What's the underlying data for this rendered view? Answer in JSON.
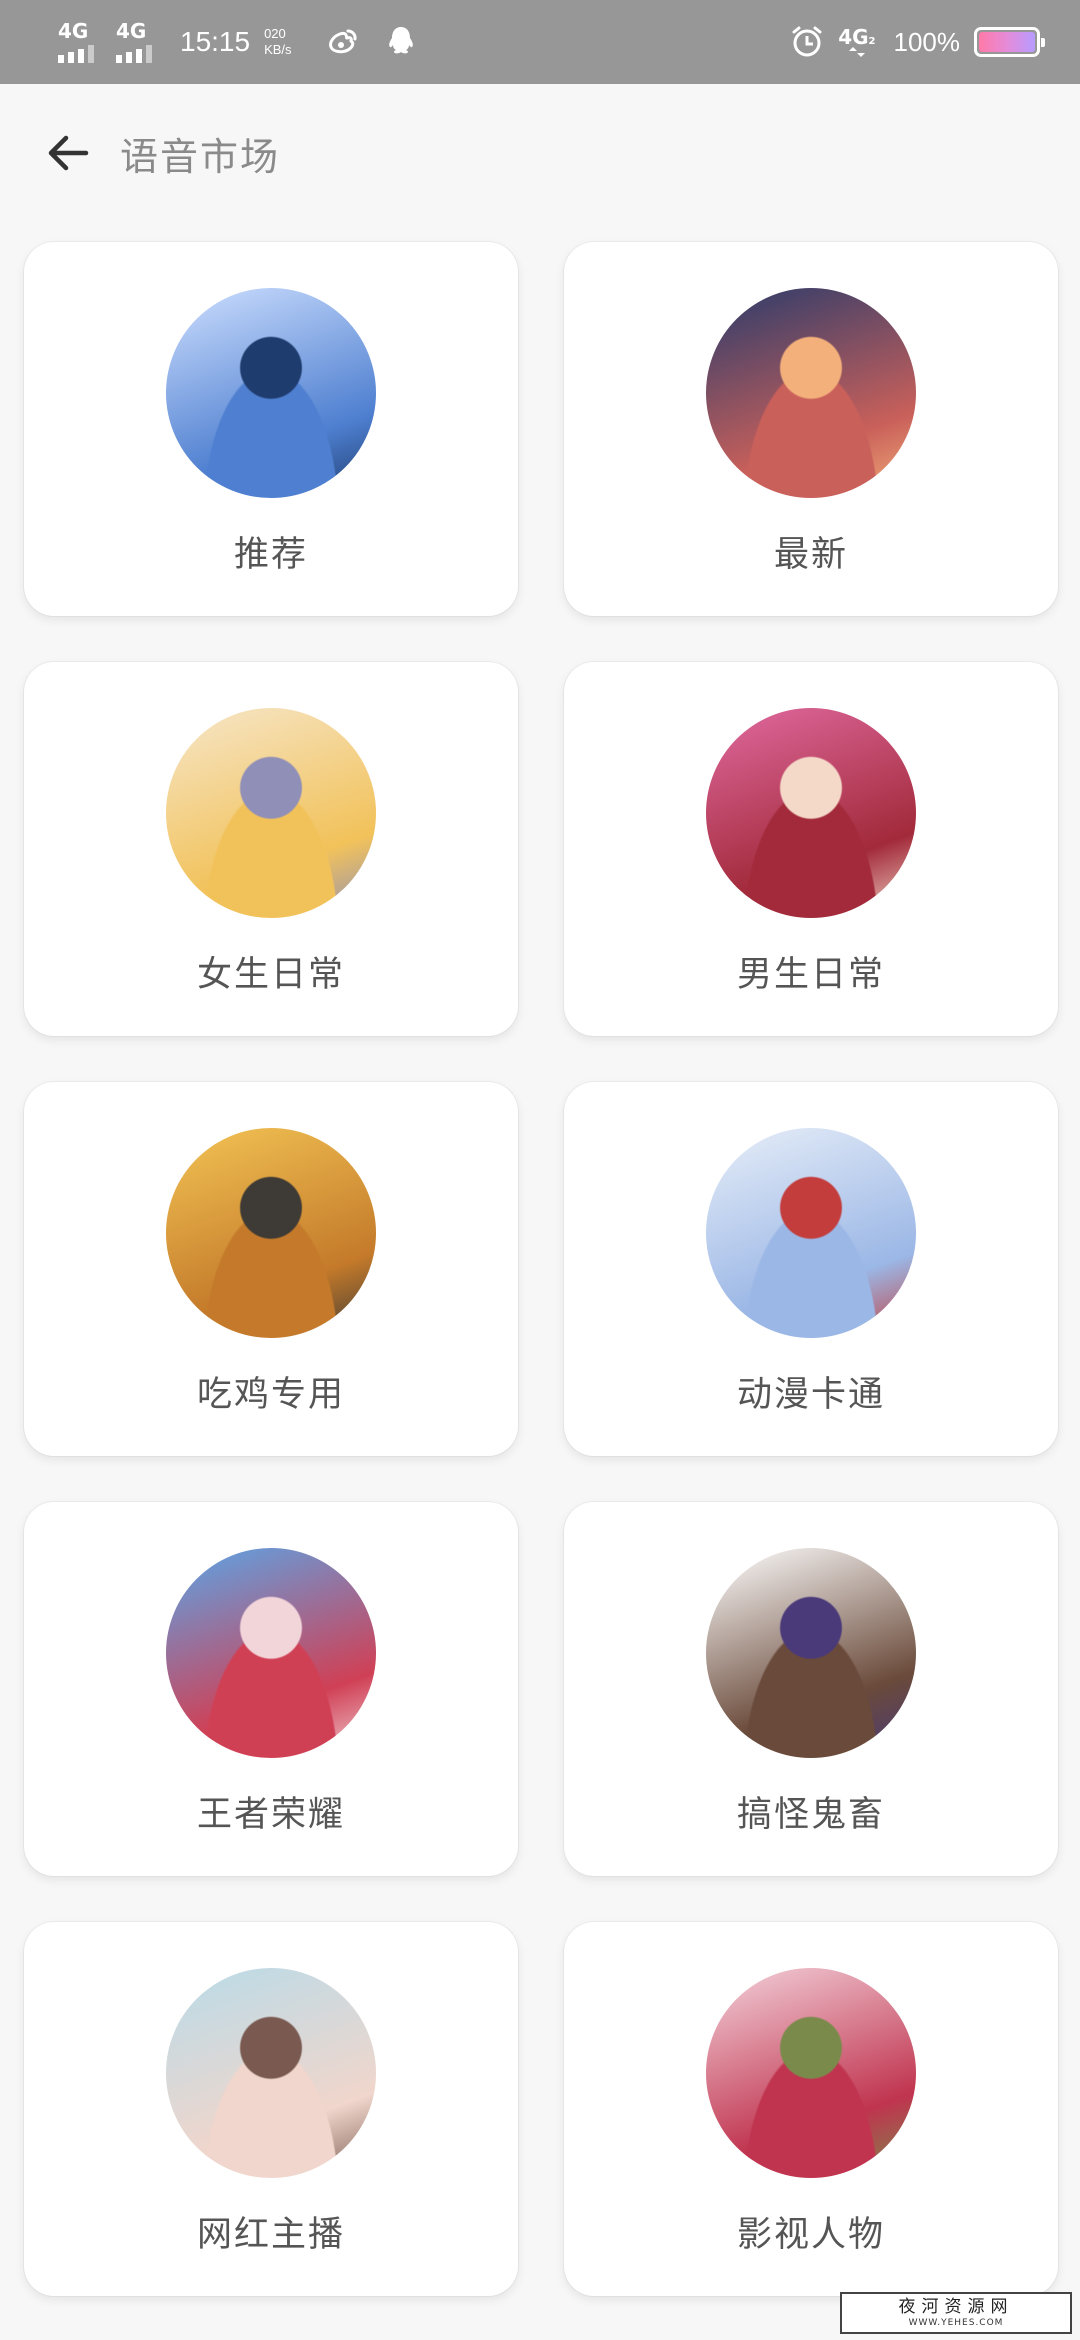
{
  "status_bar": {
    "network1": "4G",
    "network2": "4G",
    "time": "15:15",
    "speed_value": "020",
    "speed_unit": "KB/s",
    "sim2_label": "4G",
    "sim2_sub": "2",
    "battery": "100%",
    "icons": [
      "weibo-icon",
      "qq-icon",
      "alarm-icon"
    ]
  },
  "header": {
    "title": "语音市场",
    "back_icon": "arrow-left-icon"
  },
  "categories": [
    {
      "label": "推荐",
      "avatar_colors": [
        "#cfe0ff",
        "#4e7fd0",
        "#1f3c6e"
      ]
    },
    {
      "label": "最新",
      "avatar_colors": [
        "#2a3b6b",
        "#c9605a",
        "#f3b07a"
      ]
    },
    {
      "label": "女生日常",
      "avatar_colors": [
        "#f6e6c9",
        "#f2c25a",
        "#8f8fb8"
      ]
    },
    {
      "label": "男生日常",
      "avatar_colors": [
        "#e06aa0",
        "#a22a3a",
        "#f4d9c8"
      ]
    },
    {
      "label": "吃鸡专用",
      "avatar_colors": [
        "#f3c455",
        "#c47a2a",
        "#3e3a35"
      ]
    },
    {
      "label": "动漫卡通",
      "avatar_colors": [
        "#e7eef8",
        "#9bb7e6",
        "#c33d3d"
      ]
    },
    {
      "label": "王者荣耀",
      "avatar_colors": [
        "#5aa6e8",
        "#d04055",
        "#f2d5d9"
      ]
    },
    {
      "label": "搞怪鬼畜",
      "avatar_colors": [
        "#ffffff",
        "#6a4a3a",
        "#4a3a7a"
      ]
    },
    {
      "label": "网红主播",
      "avatar_colors": [
        "#b9dbe8",
        "#f0d6cc",
        "#7a5a50"
      ]
    },
    {
      "label": "影视人物",
      "avatar_colors": [
        "#f4d3dc",
        "#c0344f",
        "#7a8a4a"
      ]
    }
  ],
  "watermark": {
    "main": "夜河资源网",
    "sub": "WWW.YEHES.COM"
  }
}
